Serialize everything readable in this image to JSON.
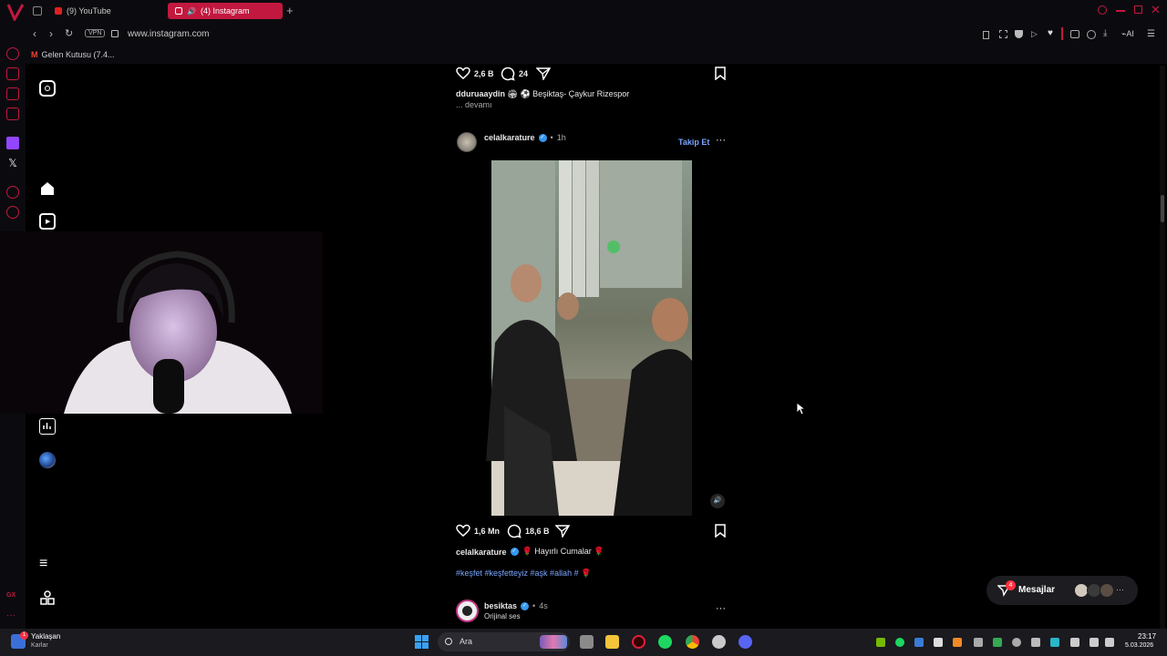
{
  "browser": {
    "tabs": [
      {
        "label": "(9) YouTube",
        "active": false
      },
      {
        "label": "(4) Instagram",
        "active": true
      }
    ],
    "new_tab": "+",
    "vpn_badge": "VPN",
    "url": "www.instagram.com",
    "ai_label": "AI",
    "bookmark": "Gelen Kutusu (7.4...",
    "accent": "#c2183f"
  },
  "feed": {
    "prev_post": {
      "likes": "2,6 B",
      "comments": "24",
      "username": "dduruaaydin",
      "caption": "🏟 ⚽ Beşiktaş- Çaykur Rizespor",
      "more": "... devamı"
    },
    "post": {
      "username": "celalkarature",
      "separator": "•",
      "time": "1h",
      "follow": "Takip Et",
      "likes": "1,6 Mn",
      "comments": "18,6 B",
      "caption": "🌹 Hayırlı Cumalar 🌹",
      "hashtags": "#keşfet #keşfetteyiz #aşk #allah # 🌹"
    },
    "next_post": {
      "username": "besiktas",
      "separator": "•",
      "time": "4s",
      "audio": "Orijinal ses"
    }
  },
  "messages": {
    "label": "Mesajlar",
    "badge": "4"
  },
  "taskbar": {
    "weather_title": "Yaklaşan",
    "weather_sub": "Karlar",
    "weather_badge": "1",
    "search_placeholder": "Ara",
    "time": "23:17",
    "date": "5.03.2026"
  },
  "colors": {
    "link": "#7aa6ff",
    "verified": "#3897f0",
    "notif": "#ff3040"
  },
  "icons": [
    "instagram-icon",
    "home-icon",
    "reels-icon",
    "insights-icon",
    "menu-icon",
    "more-icon",
    "heart-icon",
    "comment-icon",
    "share-icon",
    "bookmark-icon",
    "verified-icon",
    "volume-icon",
    "windows-icon",
    "search-icon"
  ]
}
